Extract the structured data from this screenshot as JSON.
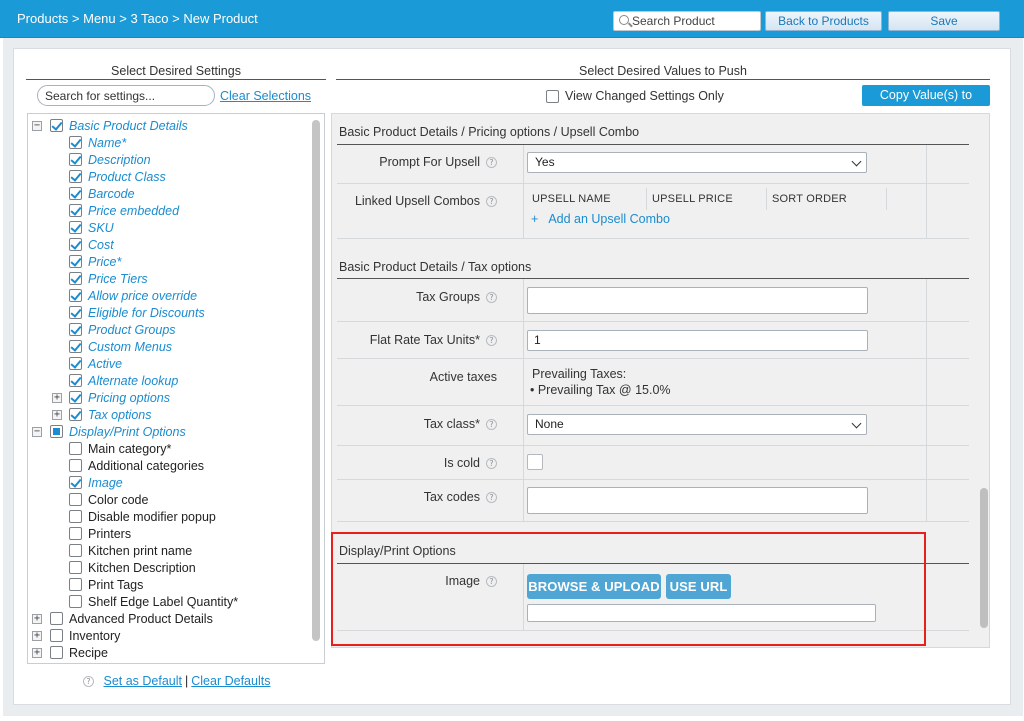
{
  "header": {
    "breadcrumb": "Products > Menu > 3 Taco > New Product",
    "search_placeholder": "Search Product",
    "back_label": "Back to Products",
    "save_label": "Save"
  },
  "left": {
    "title": "Select Desired Settings",
    "search_placeholder": "Search for settings...",
    "clear_selections": "Clear Selections",
    "tree": [
      {
        "label": "Basic Product Details",
        "state": "checked",
        "level": 0,
        "expander": "minus"
      },
      {
        "label": "Name*",
        "state": "checked",
        "level": 1
      },
      {
        "label": "Description",
        "state": "checked",
        "level": 1
      },
      {
        "label": "Product Class",
        "state": "checked",
        "level": 1
      },
      {
        "label": "Barcode",
        "state": "checked",
        "level": 1
      },
      {
        "label": "Price embedded",
        "state": "checked",
        "level": 1
      },
      {
        "label": "SKU",
        "state": "checked",
        "level": 1
      },
      {
        "label": "Cost",
        "state": "checked",
        "level": 1
      },
      {
        "label": "Price*",
        "state": "checked",
        "level": 1
      },
      {
        "label": "Price Tiers",
        "state": "checked",
        "level": 1
      },
      {
        "label": "Allow price override",
        "state": "checked",
        "level": 1
      },
      {
        "label": "Eligible for Discounts",
        "state": "checked",
        "level": 1
      },
      {
        "label": "Product Groups",
        "state": "checked",
        "level": 1
      },
      {
        "label": "Custom Menus",
        "state": "checked",
        "level": 1
      },
      {
        "label": "Active",
        "state": "checked",
        "level": 1
      },
      {
        "label": "Alternate lookup",
        "state": "checked",
        "level": 1
      },
      {
        "label": "Pricing options",
        "state": "checked",
        "level": 1,
        "expander": "plus"
      },
      {
        "label": "Tax options",
        "state": "checked",
        "level": 1,
        "expander": "plus"
      },
      {
        "label": "Display/Print Options",
        "state": "partial",
        "level": 0,
        "expander": "minus"
      },
      {
        "label": "Main category*",
        "state": "unchecked",
        "level": 1
      },
      {
        "label": "Additional categories",
        "state": "unchecked",
        "level": 1
      },
      {
        "label": "Image",
        "state": "checked",
        "level": 1
      },
      {
        "label": "Color code",
        "state": "unchecked",
        "level": 1
      },
      {
        "label": "Disable modifier popup",
        "state": "unchecked",
        "level": 1
      },
      {
        "label": "Printers",
        "state": "unchecked",
        "level": 1
      },
      {
        "label": "Kitchen print name",
        "state": "unchecked",
        "level": 1
      },
      {
        "label": "Kitchen Description",
        "state": "unchecked",
        "level": 1
      },
      {
        "label": "Print Tags",
        "state": "unchecked",
        "level": 1
      },
      {
        "label": "Shelf Edge Label Quantity*",
        "state": "unchecked",
        "level": 1
      },
      {
        "label": "Advanced Product Details",
        "state": "unchecked",
        "level": 0,
        "expander": "plus"
      },
      {
        "label": "Inventory",
        "state": "unchecked",
        "level": 0,
        "expander": "plus"
      },
      {
        "label": "Recipe",
        "state": "unchecked",
        "level": 0,
        "expander": "plus"
      }
    ],
    "set_default": "Set as Default",
    "separator": "|",
    "clear_defaults": "Clear Defaults"
  },
  "right": {
    "title": "Select Desired Values to Push",
    "view_changed": "View Changed Settings Only",
    "copy_values": "Copy Value(s) to",
    "section_upsell": "Basic Product Details / Pricing options / Upsell Combo",
    "prompt_for_upsell_label": "Prompt For Upsell",
    "prompt_for_upsell_value": "Yes",
    "linked_upsell_label": "Linked Upsell Combos",
    "upsell_cols": [
      "UPSELL NAME",
      "UPSELL PRICE",
      "SORT ORDER"
    ],
    "add_upsell_plus": "+",
    "add_upsell": "Add an Upsell Combo",
    "section_tax": "Basic Product Details / Tax options",
    "tax_groups_label": "Tax Groups",
    "tax_groups_value": "",
    "flat_rate_label": "Flat Rate Tax Units*",
    "flat_rate_value": "1",
    "active_taxes_label": "Active taxes",
    "prevailing_title": "Prevailing Taxes:",
    "prevailing_item": "• Prevailing Tax  @ 15.0%",
    "tax_class_label": "Tax class*",
    "tax_class_value": "None",
    "is_cold_label": "Is cold",
    "tax_codes_label": "Tax codes",
    "tax_codes_value": "",
    "section_display": "Display/Print Options",
    "image_label": "Image",
    "browse_upload": "BROWSE & UPLOAD",
    "use_url": "USE URL",
    "image_url_value": ""
  },
  "colors": {
    "header_blue": "#1a9ad6",
    "link_blue": "#1a8ccf",
    "button_blue": "#4fa6d4",
    "highlight_red": "#e8201c"
  },
  "icons": {
    "help": "?",
    "search": "search-icon",
    "chevron": "chevron-down-icon",
    "expand": "+",
    "collapse": "−"
  }
}
